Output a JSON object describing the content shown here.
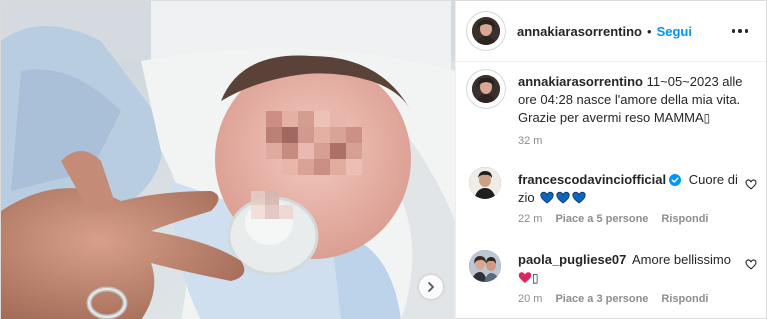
{
  "post": {
    "author": "annakiarasorrentino",
    "separator": "•",
    "follow_label": "Segui",
    "more_icon": "more-horizontal-icon"
  },
  "caption": {
    "user": "annakiarasorrentino",
    "text": "11~05~2023 alle ore 04:28 nasce l'amore della mia vita. Grazie per avermi reso MAMMA",
    "trailing_glyph": "▯",
    "time": "32 m"
  },
  "comments": [
    {
      "user": "francescodavinciofficial",
      "verified": true,
      "text": "Cuore di zio",
      "emoji": [
        "blue-heart",
        "blue-heart",
        "blue-heart"
      ],
      "time": "22 m",
      "likes": "Piace a 5 persone",
      "reply": "Rispondi"
    },
    {
      "user": "paola_pugliese07",
      "verified": false,
      "text": "Amore bellissimo",
      "emoji": [
        "red-heart"
      ],
      "trailing_glyph": "▯",
      "time": "20 m",
      "likes": "Piace a 3 persone",
      "reply": "Rispondi"
    }
  ],
  "colors": {
    "link": "#0095f6",
    "verified": "#0095f6",
    "muted": "#8e8e8e",
    "text": "#262626",
    "blue_heart": "#0a66c2",
    "red_heart": "#e0245e"
  }
}
